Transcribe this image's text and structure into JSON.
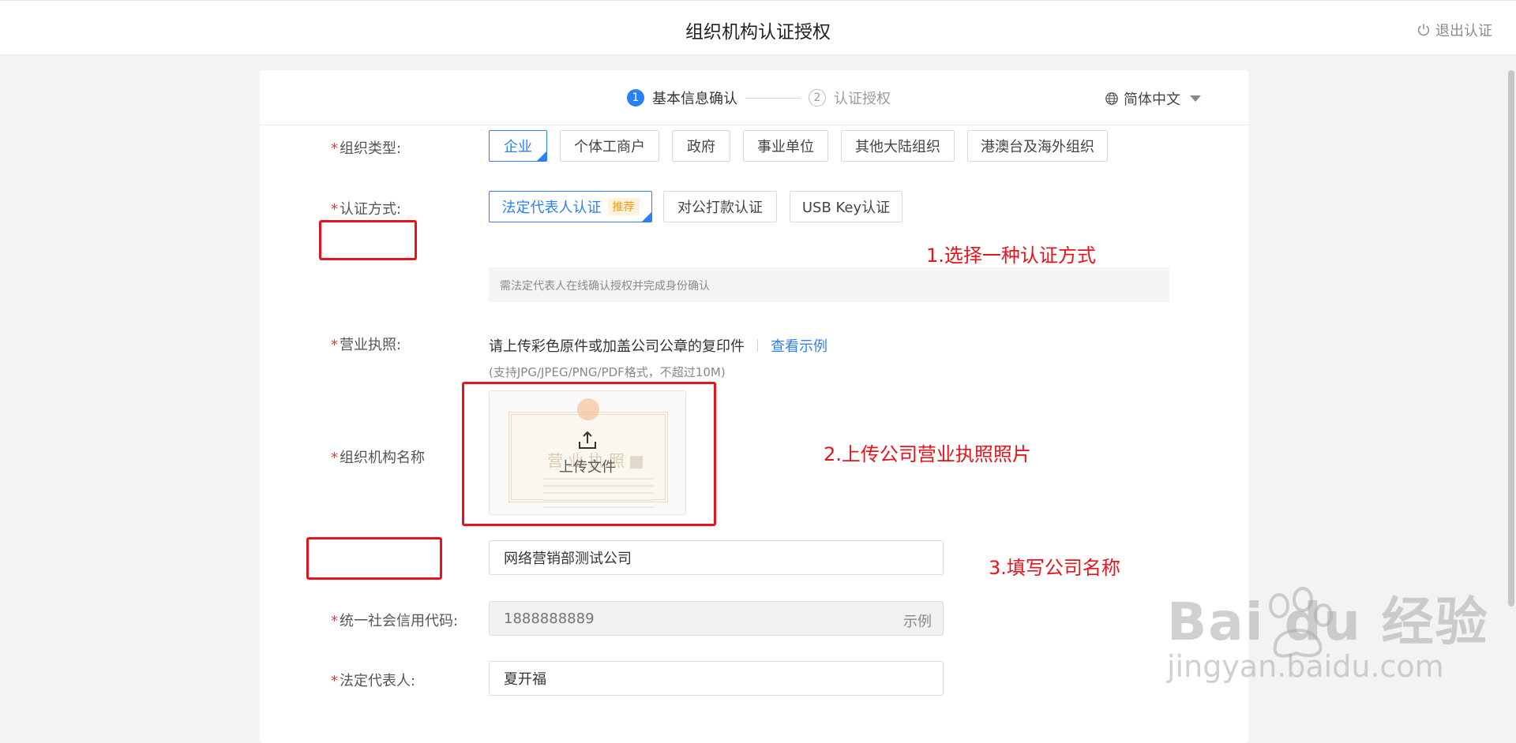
{
  "header": {
    "title": "组织机构认证授权",
    "logout_label": "退出认证"
  },
  "steps": [
    {
      "num": "1",
      "label": "基本信息确认",
      "active": true
    },
    {
      "num": "2",
      "label": "认证授权",
      "active": false
    }
  ],
  "language": {
    "selected": "简体中文"
  },
  "form": {
    "org_type": {
      "label": "组织类型:",
      "options": [
        "企业",
        "个体工商户",
        "政府",
        "事业单位",
        "其他大陆组织",
        "港澳台及海外组织"
      ],
      "selected": "企业"
    },
    "auth_method": {
      "label": "认证方式:",
      "options": [
        "法定代表人认证",
        "对公打款认证",
        "USB Key认证"
      ],
      "recommended_badge": "推荐",
      "selected": "法定代表人认证",
      "hint": "需法定代表人在线确认授权并完成身份确认"
    },
    "license": {
      "label": "营业执照:",
      "description": "请上传彩色原件或加盖公司公章的复印件",
      "example_link": "查看示例",
      "note": "(支持JPG/JPEG/PNG/PDF格式，不超过10M)",
      "sample_title": "营业执照",
      "upload_label": "上传文件"
    },
    "org_name": {
      "label": "组织机构名称",
      "value": "网络营销部测试公司"
    },
    "credit_code": {
      "label": "统一社会信用代码:",
      "placeholder": "1888888889",
      "suffix": "示例"
    },
    "legal_rep": {
      "label": "法定代表人:",
      "value": "夏开福"
    }
  },
  "annotations": {
    "step1": "1.选择一种认证方式",
    "step2": "2.上传公司营业执照照片",
    "step3": "3.填写公司名称"
  },
  "watermark": {
    "main": "Bai du 经验",
    "sub": "jingyan.baidu.com"
  },
  "colors": {
    "accent": "#2b7ff7",
    "annotation": "#e8131b",
    "required": "#e53935",
    "badge": "#f39c12"
  }
}
